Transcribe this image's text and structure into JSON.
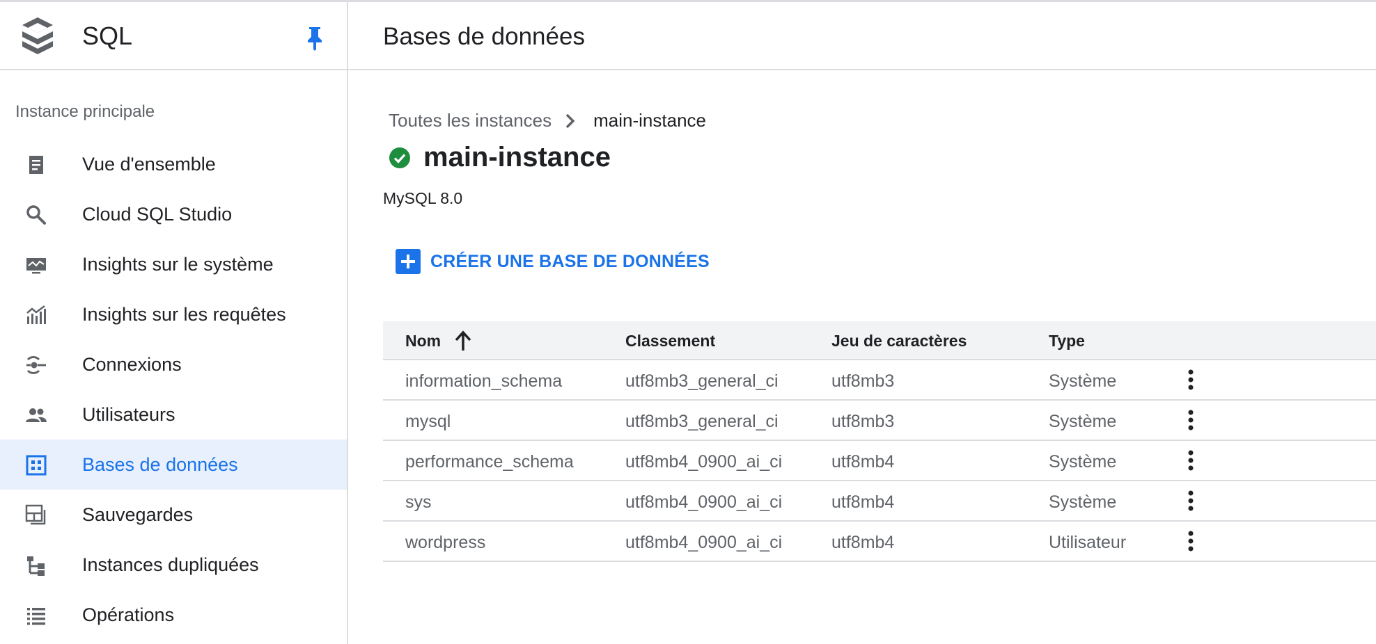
{
  "sidebar": {
    "title": "SQL",
    "section": "Instance principale",
    "items": [
      {
        "label": "Vue d'ensemble",
        "icon": "overview-icon"
      },
      {
        "label": "Cloud SQL Studio",
        "icon": "search-icon"
      },
      {
        "label": "Insights sur le système",
        "icon": "monitor-icon"
      },
      {
        "label": "Insights sur les requêtes",
        "icon": "chart-icon"
      },
      {
        "label": "Connexions",
        "icon": "connection-icon"
      },
      {
        "label": "Utilisateurs",
        "icon": "users-icon"
      },
      {
        "label": "Bases de données",
        "icon": "database-icon",
        "active": true
      },
      {
        "label": "Sauvegardes",
        "icon": "backup-icon"
      },
      {
        "label": "Instances dupliquées",
        "icon": "replica-icon"
      },
      {
        "label": "Opérations",
        "icon": "list-icon"
      }
    ]
  },
  "header": {
    "title": "Bases de données"
  },
  "breadcrumb": {
    "parent": "Toutes les instances",
    "current": "main-instance"
  },
  "instance": {
    "name": "main-instance",
    "version": "MySQL 8.0",
    "status": "running"
  },
  "create_button": {
    "label": "CRÉER UNE BASE DE DONNÉES"
  },
  "table": {
    "columns": [
      "Nom",
      "Classement",
      "Jeu de caractères",
      "Type"
    ],
    "sort": "ascending",
    "rows": [
      {
        "name": "information_schema",
        "collation": "utf8mb3_general_ci",
        "charset": "utf8mb3",
        "type": "Système"
      },
      {
        "name": "mysql",
        "collation": "utf8mb3_general_ci",
        "charset": "utf8mb3",
        "type": "Système"
      },
      {
        "name": "performance_schema",
        "collation": "utf8mb4_0900_ai_ci",
        "charset": "utf8mb4",
        "type": "Système"
      },
      {
        "name": "sys",
        "collation": "utf8mb4_0900_ai_ci",
        "charset": "utf8mb4",
        "type": "Système"
      },
      {
        "name": "wordpress",
        "collation": "utf8mb4_0900_ai_ci",
        "charset": "utf8mb4",
        "type": "Utilisateur"
      }
    ]
  },
  "colors": {
    "accent": "#1a73e8",
    "success": "#1e8e3e",
    "active_bg": "#e8f0fe",
    "icon": "#5f6368"
  }
}
